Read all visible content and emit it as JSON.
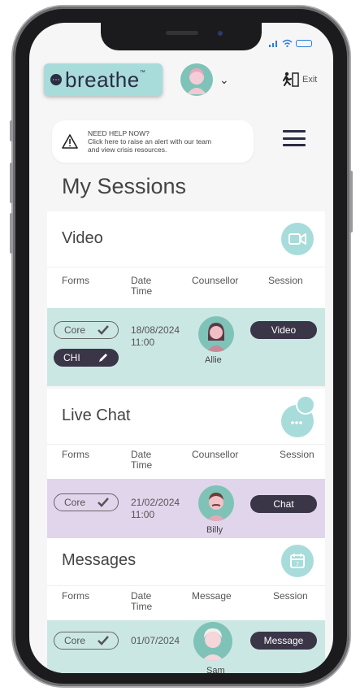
{
  "app": {
    "logo_text": "breathe",
    "logo_tm": "™",
    "exit_label": "Exit"
  },
  "help": {
    "heading": "NEED HELP NOW?",
    "line1": "Click here to raise an alert with our team",
    "line2": "and view crisis resources."
  },
  "page_title": "My Sessions",
  "sections": {
    "video": {
      "title": "Video",
      "columns": [
        "Forms",
        "Date",
        "Time",
        "Counsellor",
        "Session"
      ],
      "row": {
        "form1": "Core",
        "form2": "CHI",
        "date": "18/08/2024",
        "time": "11:00",
        "counsellor": "Allie",
        "session_button": "Video"
      }
    },
    "chat": {
      "title": "Live Chat",
      "columns": [
        "Forms",
        "Date",
        "Time",
        "Counsellor",
        "Session"
      ],
      "row": {
        "form1": "Core",
        "date": "21/02/2024",
        "time": "11:00",
        "counsellor": "Billy",
        "session_button": "Chat"
      }
    },
    "messages": {
      "title": "Messages",
      "columns": [
        "Forms",
        "Date",
        "Time",
        "Message",
        "Session"
      ],
      "row": {
        "form1": "Core",
        "date": "01/07/2024",
        "counsellor": "Sam",
        "session_button": "Message"
      }
    }
  },
  "colors": {
    "teal": "#a7dcdb",
    "teal_row": "#cbe7e4",
    "purple_row": "#e1d5ec",
    "dark": "#3b3548"
  }
}
